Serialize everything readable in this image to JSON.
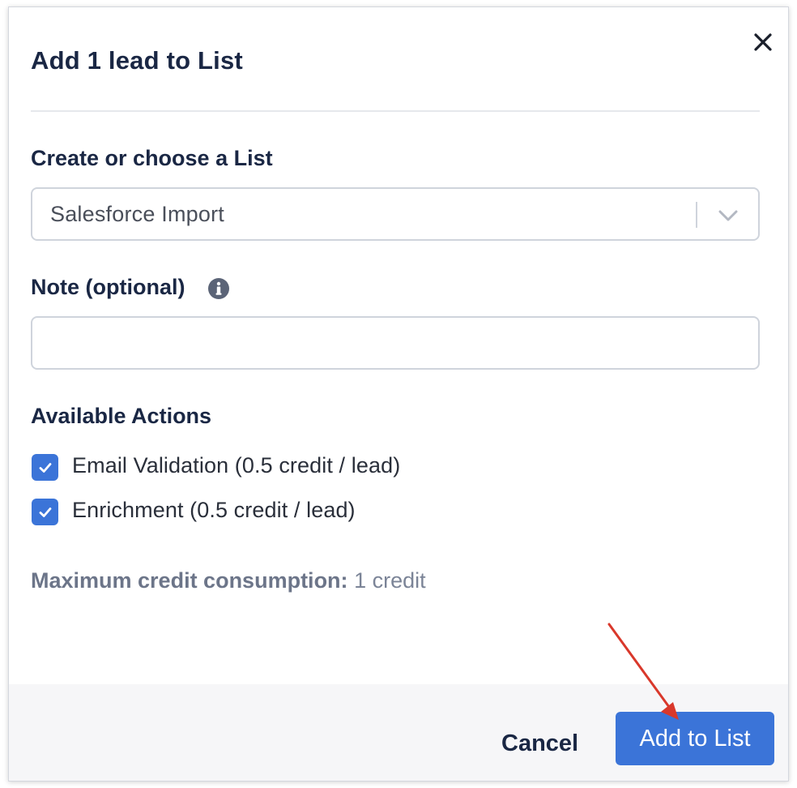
{
  "dialog": {
    "title": "Add 1 lead to List",
    "close_icon": "close-icon"
  },
  "list_select": {
    "label": "Create or choose a List",
    "value": "Salesforce Import",
    "chevron_icon": "chevron-down-icon"
  },
  "note": {
    "label": "Note (optional)",
    "value": "",
    "info_icon": "info-icon"
  },
  "actions": {
    "label": "Available Actions",
    "items": [
      {
        "label": "Email Validation (0.5 credit / lead)",
        "checked": true
      },
      {
        "label": "Enrichment (0.5 credit / lead)",
        "checked": true
      }
    ]
  },
  "credit": {
    "label": "Maximum credit consumption:",
    "value": "1 credit"
  },
  "footer": {
    "cancel_label": "Cancel",
    "submit_label": "Add to List"
  },
  "colors": {
    "primary": "#3b74d8",
    "heading": "#1a2744",
    "muted": "#7b8497",
    "annotation_arrow": "#d9382b"
  }
}
